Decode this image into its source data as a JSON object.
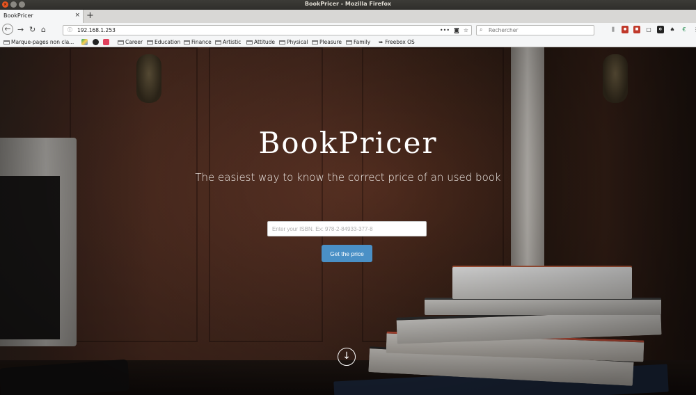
{
  "window": {
    "title": "BookPricer - Mozilla Firefox"
  },
  "tab": {
    "label": "BookPricer",
    "close": "×",
    "new_tab": "+"
  },
  "nav": {
    "url": "192.168.1.253",
    "page_actions": "•••",
    "search_placeholder": "Rechercher"
  },
  "bookmarks": [
    {
      "label": "Marque-pages non cla..."
    },
    {
      "label": "Career"
    },
    {
      "label": "Education"
    },
    {
      "label": "Finance"
    },
    {
      "label": "Artistic"
    },
    {
      "label": "Attitude"
    },
    {
      "label": "Physical"
    },
    {
      "label": "Pleasure"
    },
    {
      "label": "Family"
    },
    {
      "label": "Freebox OS"
    }
  ],
  "hero": {
    "title": "BookPricer",
    "subtitle": "The easiest way to know the correct price of an used book",
    "isbn_placeholder": "Enter your ISBN. Ex: 978-2-84933-377-8",
    "button_label": "Get the price",
    "scroll_icon": "arrow-down-circle-icon"
  },
  "colors": {
    "button": "#4a90c6",
    "accent_close": "#e95420"
  }
}
